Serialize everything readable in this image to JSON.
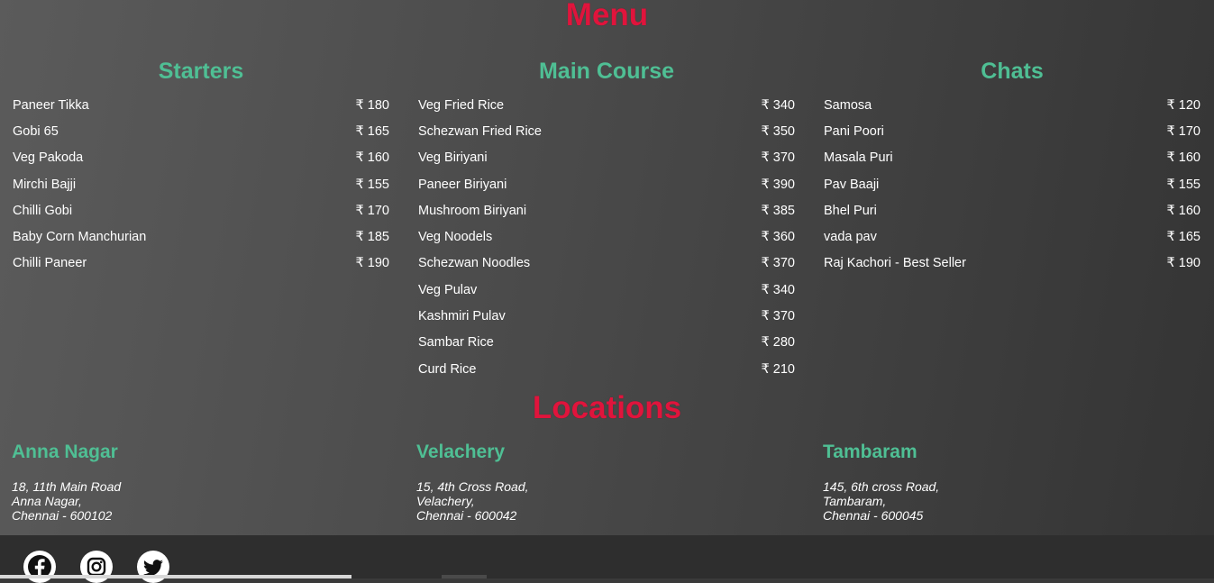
{
  "menu": {
    "title": "Menu",
    "columns": [
      {
        "heading": "Starters",
        "items": [
          {
            "name": "Paneer Tikka",
            "price": "₹ 180"
          },
          {
            "name": "Gobi 65",
            "price": "₹ 165"
          },
          {
            "name": "Veg Pakoda",
            "price": "₹ 160"
          },
          {
            "name": "Mirchi Bajji",
            "price": "₹ 155"
          },
          {
            "name": "Chilli Gobi",
            "price": "₹ 170"
          },
          {
            "name": "Baby Corn Manchurian",
            "price": "₹ 185"
          },
          {
            "name": "Chilli Paneer",
            "price": "₹ 190"
          }
        ]
      },
      {
        "heading": "Main Course",
        "items": [
          {
            "name": "Veg Fried Rice",
            "price": "₹ 340"
          },
          {
            "name": "Schezwan Fried Rice",
            "price": "₹ 350"
          },
          {
            "name": "Veg Biriyani",
            "price": "₹ 370"
          },
          {
            "name": "Paneer Biriyani",
            "price": "₹ 390"
          },
          {
            "name": "Mushroom Biriyani",
            "price": "₹ 385"
          },
          {
            "name": "Veg Noodels",
            "price": "₹ 360"
          },
          {
            "name": "Schezwan Noodles",
            "price": "₹ 370"
          },
          {
            "name": "Veg Pulav",
            "price": "₹ 340"
          },
          {
            "name": "Kashmiri Pulav",
            "price": "₹ 370"
          },
          {
            "name": "Sambar Rice",
            "price": "₹ 280"
          },
          {
            "name": "Curd Rice",
            "price": "₹ 210"
          }
        ]
      },
      {
        "heading": "Chats",
        "items": [
          {
            "name": "Samosa",
            "price": "₹ 120"
          },
          {
            "name": "Pani Poori",
            "price": "₹ 170"
          },
          {
            "name": "Masala Puri",
            "price": "₹ 160"
          },
          {
            "name": "Pav Baaji",
            "price": "₹ 155"
          },
          {
            "name": "Bhel Puri",
            "price": "₹ 160"
          },
          {
            "name": "vada pav",
            "price": "₹ 165"
          },
          {
            "name": "Raj Kachori - Best Seller",
            "price": "₹ 190"
          }
        ]
      }
    ]
  },
  "locations": {
    "title": "Locations",
    "items": [
      {
        "name": "Anna Nagar",
        "lines": [
          "18, 11th Main Road",
          "Anna Nagar,",
          "Chennai - 600102"
        ]
      },
      {
        "name": "Velachery",
        "lines": [
          "15, 4th Cross Road,",
          "Velachery,",
          "Chennai - 600042"
        ]
      },
      {
        "name": "Tambaram",
        "lines": [
          "145, 6th cross Road,",
          "Tambaram,",
          "Chennai - 600045"
        ]
      }
    ]
  },
  "footer": {
    "social": [
      {
        "icon": "facebook-icon"
      },
      {
        "icon": "instagram-icon"
      },
      {
        "icon": "twitter-icon"
      }
    ]
  },
  "colors": {
    "section_title": "#e0143c",
    "heading": "#4fbf94",
    "text": "#ffffff"
  }
}
